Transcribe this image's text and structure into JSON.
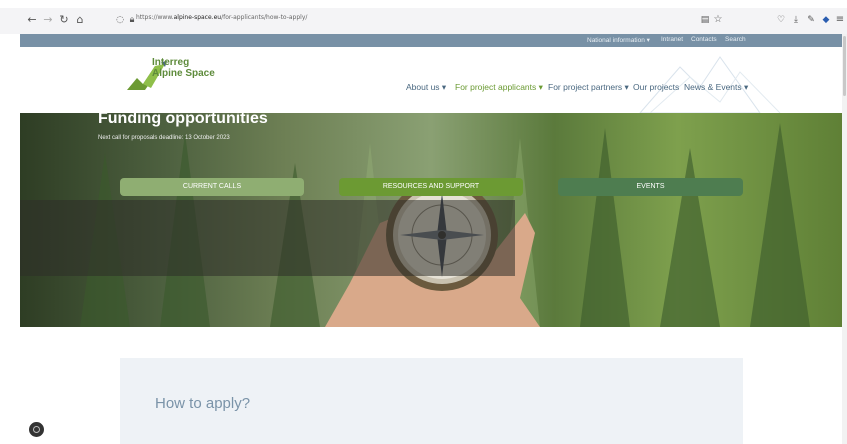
{
  "browser": {
    "url_prefix": "https://www.",
    "url_domain": "alpine-space.eu",
    "url_path": "/for-applicants/how-to-apply/",
    "back_icon": "arrow-left-icon",
    "forward_icon": "arrow-right-icon",
    "reload_icon": "reload-icon",
    "home_icon": "home-icon"
  },
  "topbar": {
    "items": [
      "National information ▾",
      "Intranet",
      "Contacts",
      "Search"
    ]
  },
  "logo": {
    "line1": "Interreg",
    "line2": "Alpine Space"
  },
  "nav": {
    "items": [
      {
        "label": "About us ▾"
      },
      {
        "label": "For project applicants ▾"
      },
      {
        "label": "For project partners ▾"
      },
      {
        "label": "Our projects"
      },
      {
        "label": "News & Events ▾"
      }
    ]
  },
  "hero": {
    "title": "Funding opportunities",
    "subtitle": "Next call for proposals deadline: 13 October 2023",
    "buttons": [
      {
        "label": "CURRENT CALLS",
        "color": "#8fae72"
      },
      {
        "label": "RESOURCES AND SUPPORT",
        "color": "#6c9a33"
      },
      {
        "label": "EVENTS",
        "color": "#4e7d50"
      }
    ]
  },
  "content": {
    "heading": "How to apply?"
  },
  "colors": {
    "topbar": "#7891a6",
    "nav_text": "#4a6880",
    "nav_active": "#6a9a32",
    "brand_green": "#5e8b3b"
  }
}
